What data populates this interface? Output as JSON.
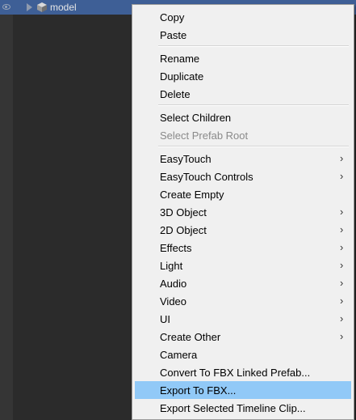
{
  "hierarchy": {
    "row_label": "model"
  },
  "menu": {
    "groups": [
      {
        "items": [
          {
            "label": "Copy",
            "submenu": false,
            "disabled": false
          },
          {
            "label": "Paste",
            "submenu": false,
            "disabled": false
          }
        ]
      },
      {
        "items": [
          {
            "label": "Rename",
            "submenu": false,
            "disabled": false
          },
          {
            "label": "Duplicate",
            "submenu": false,
            "disabled": false
          },
          {
            "label": "Delete",
            "submenu": false,
            "disabled": false
          }
        ]
      },
      {
        "items": [
          {
            "label": "Select Children",
            "submenu": false,
            "disabled": false
          },
          {
            "label": "Select Prefab Root",
            "submenu": false,
            "disabled": true
          }
        ]
      },
      {
        "items": [
          {
            "label": "EasyTouch",
            "submenu": true,
            "disabled": false
          },
          {
            "label": "EasyTouch Controls",
            "submenu": true,
            "disabled": false
          },
          {
            "label": "Create Empty",
            "submenu": false,
            "disabled": false
          },
          {
            "label": "3D Object",
            "submenu": true,
            "disabled": false
          },
          {
            "label": "2D Object",
            "submenu": true,
            "disabled": false
          },
          {
            "label": "Effects",
            "submenu": true,
            "disabled": false
          },
          {
            "label": "Light",
            "submenu": true,
            "disabled": false
          },
          {
            "label": "Audio",
            "submenu": true,
            "disabled": false
          },
          {
            "label": "Video",
            "submenu": true,
            "disabled": false
          },
          {
            "label": "UI",
            "submenu": true,
            "disabled": false
          },
          {
            "label": "Create Other",
            "submenu": true,
            "disabled": false
          },
          {
            "label": "Camera",
            "submenu": false,
            "disabled": false
          },
          {
            "label": "Convert To FBX Linked Prefab...",
            "submenu": false,
            "disabled": false
          },
          {
            "label": "Export To FBX...",
            "submenu": false,
            "disabled": false,
            "highlighted": true
          },
          {
            "label": "Export Selected Timeline Clip...",
            "submenu": false,
            "disabled": false
          }
        ]
      }
    ],
    "submenu_arrow": "›"
  },
  "colors": {
    "selection_row": "#3e5f96",
    "menu_highlight": "#91c9f7",
    "menu_background": "#f0f0f0"
  }
}
